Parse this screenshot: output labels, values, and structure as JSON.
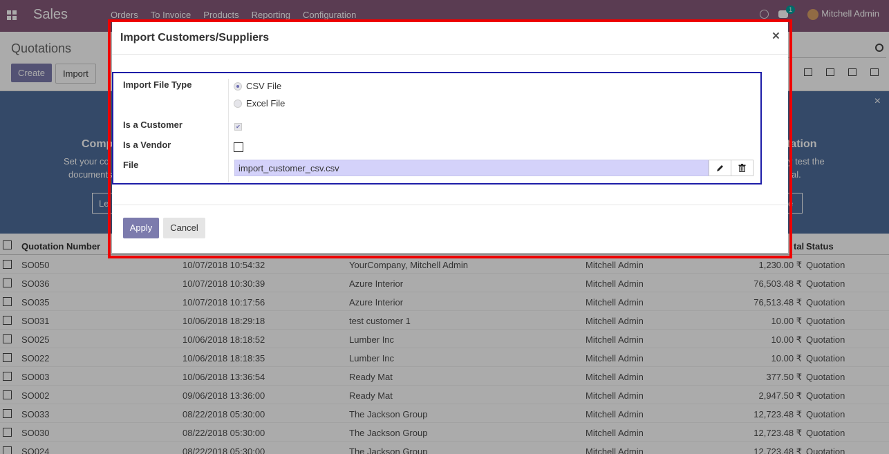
{
  "navbar": {
    "app_name": "Sales",
    "menu": [
      "Orders",
      "To Invoice",
      "Products",
      "Reporting",
      "Configuration"
    ],
    "chat_count": "1",
    "user_name": "Mitchell Admin"
  },
  "control": {
    "breadcrumb": "Quotations",
    "create_label": "Create",
    "import_label": "Import"
  },
  "banner": {
    "left_title": "Comp",
    "left_text1": "Set your co",
    "left_text2": "documents",
    "left_button": "Le",
    "right_title": "tation",
    "right_text1": "y test the",
    "right_text2": "al.",
    "right_button": "e",
    "close_glyph": "×"
  },
  "table": {
    "headers": [
      "Quotation Number",
      "tal",
      "Status"
    ],
    "rows": [
      {
        "number": "SO050",
        "date": "10/07/2018 10:54:32",
        "customer": "YourCompany, Mitchell Admin",
        "salesperson": "Mitchell Admin",
        "total": "1,230.00 ₹",
        "status": "Quotation"
      },
      {
        "number": "SO036",
        "date": "10/07/2018 10:30:39",
        "customer": "Azure Interior",
        "salesperson": "Mitchell Admin",
        "total": "76,503.48 ₹",
        "status": "Quotation"
      },
      {
        "number": "SO035",
        "date": "10/07/2018 10:17:56",
        "customer": "Azure Interior",
        "salesperson": "Mitchell Admin",
        "total": "76,513.48 ₹",
        "status": "Quotation"
      },
      {
        "number": "SO031",
        "date": "10/06/2018 18:29:18",
        "customer": "test customer 1",
        "salesperson": "Mitchell Admin",
        "total": "10.00 ₹",
        "status": "Quotation"
      },
      {
        "number": "SO025",
        "date": "10/06/2018 18:18:52",
        "customer": "Lumber Inc",
        "salesperson": "Mitchell Admin",
        "total": "10.00 ₹",
        "status": "Quotation"
      },
      {
        "number": "SO022",
        "date": "10/06/2018 18:18:35",
        "customer": "Lumber Inc",
        "salesperson": "Mitchell Admin",
        "total": "10.00 ₹",
        "status": "Quotation"
      },
      {
        "number": "SO003",
        "date": "10/06/2018 13:36:54",
        "customer": "Ready Mat",
        "salesperson": "Mitchell Admin",
        "total": "377.50 ₹",
        "status": "Quotation"
      },
      {
        "number": "SO002",
        "date": "09/06/2018 13:36:00",
        "customer": "Ready Mat",
        "salesperson": "Mitchell Admin",
        "total": "2,947.50 ₹",
        "status": "Quotation"
      },
      {
        "number": "SO033",
        "date": "08/22/2018 05:30:00",
        "customer": "The Jackson Group",
        "salesperson": "Mitchell Admin",
        "total": "12,723.48 ₹",
        "status": "Quotation"
      },
      {
        "number": "SO030",
        "date": "08/22/2018 05:30:00",
        "customer": "The Jackson Group",
        "salesperson": "Mitchell Admin",
        "total": "12,723.48 ₹",
        "status": "Quotation"
      },
      {
        "number": "SO024",
        "date": "08/22/2018 05:30:00",
        "customer": "The Jackson Group",
        "salesperson": "Mitchell Admin",
        "total": "12,723.48 ₹",
        "status": "Quotation"
      }
    ]
  },
  "modal": {
    "title": "Import Customers/Suppliers",
    "close_glyph": "×",
    "file_type_label": "Import File Type",
    "options": [
      "CSV File",
      "Excel File"
    ],
    "selected_option": "CSV File",
    "is_customer_label": "Is a Customer",
    "is_customer": true,
    "is_vendor_label": "Is a Vendor",
    "is_vendor": false,
    "file_label": "File",
    "file_value": "import_customer_csv.csv",
    "apply_label": "Apply",
    "cancel_label": "Cancel"
  },
  "colors": {
    "brand": "#875a7b",
    "primary": "#7c7bad",
    "highlight_red": "#ee0000",
    "highlight_blue": "#1d1da8"
  }
}
